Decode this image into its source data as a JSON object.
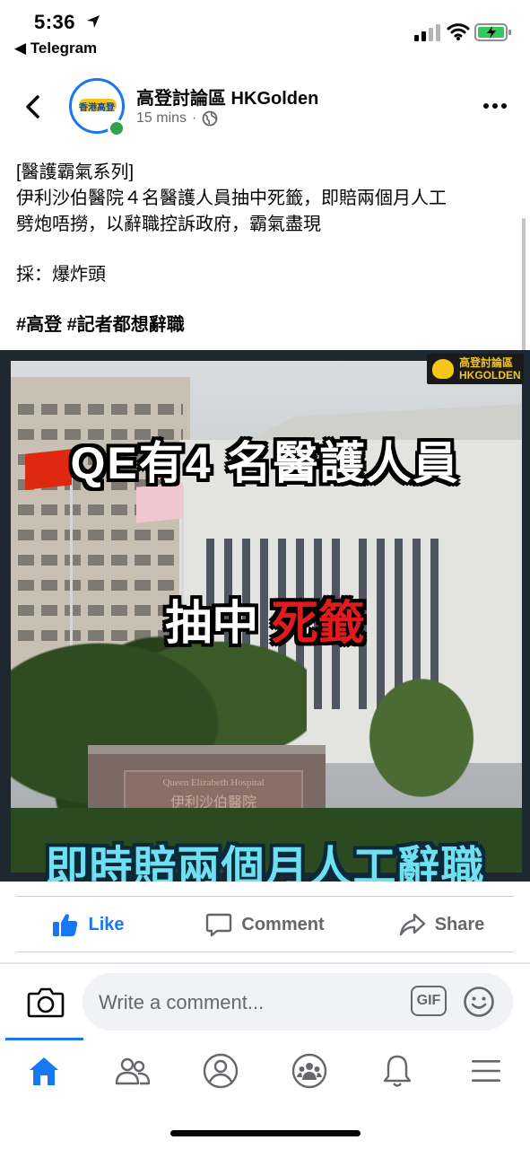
{
  "status_bar": {
    "time": "5:36",
    "back_app": "Telegram",
    "icons": [
      "location-arrow-icon",
      "signal-icon",
      "wifi-icon",
      "battery-charging-icon"
    ]
  },
  "post": {
    "page_name": "高登討論區 HKGolden",
    "timestamp": "15 mins",
    "separator": "·",
    "audience_icon": "globe-icon",
    "avatar_text": "香港高登",
    "text_lines": [
      "[醫護霸氣系列]",
      "伊利沙伯醫院４名醫護人員抽中死籤，即賠兩個月人工",
      "劈炮唔撈，以辭職控訴政府，霸氣盡現"
    ],
    "reporter": "採：爆炸頭",
    "hashtags": "#高登 #記者都想辭職"
  },
  "image": {
    "watermark_line1": "高登討論區",
    "watermark_line2": "HKGOLDEN",
    "caption_top": "QE有4 名醫護人員",
    "caption_mid_white": "抽中 ",
    "caption_mid_red": "死籤",
    "caption_bottom": "即時賠兩個月人工辭職",
    "sign_text_en": "Queen Elizabeth Hospital",
    "sign_text_zh": "伊利沙伯醫院",
    "colors": {
      "caption_red": "#e01b1b",
      "caption_cyan": "#6ee0f2"
    }
  },
  "actions": {
    "like": "Like",
    "comment": "Comment",
    "share": "Share"
  },
  "comment_box": {
    "placeholder": "Write a comment...",
    "gif_label": "GIF"
  },
  "nav": {
    "items": [
      "home-icon",
      "friends-icon",
      "profile-icon",
      "groups-icon",
      "notifications-icon",
      "menu-icon"
    ],
    "active": "home-icon"
  },
  "colors": {
    "accent": "#1877f2",
    "secondary_text": "#65676b",
    "online": "#31a24c"
  }
}
